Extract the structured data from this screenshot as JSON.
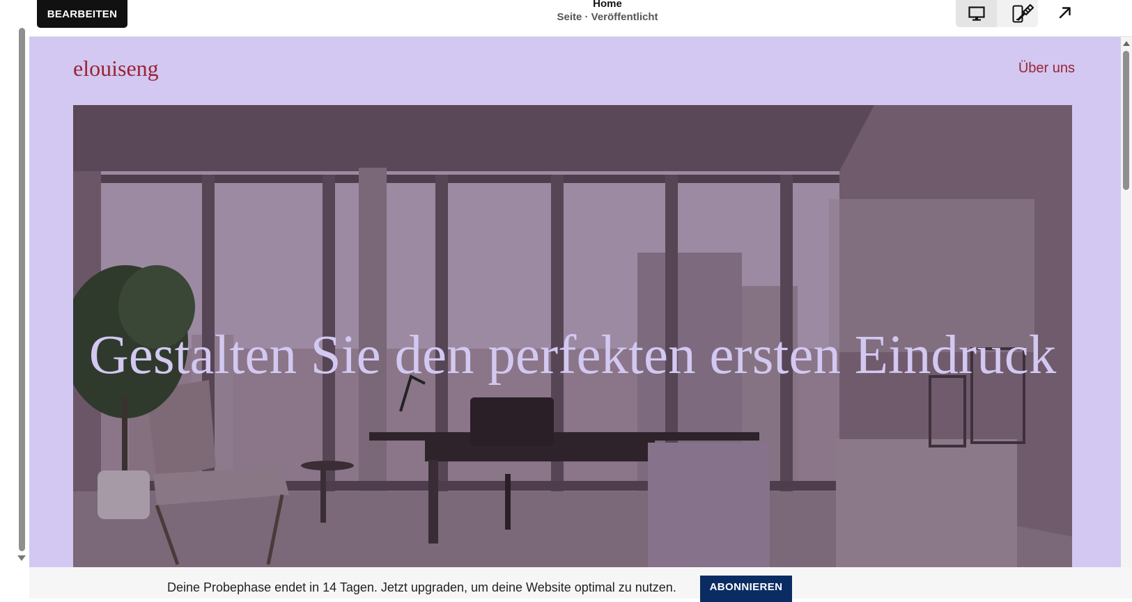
{
  "editor": {
    "edit_label": "BEARBEITEN",
    "page_title": "Home",
    "page_status": "Seite · Veröffentlicht",
    "icons": {
      "desktop": "desktop-icon",
      "mobile": "mobile-icon",
      "style": "paintbrush-icon",
      "open": "arrow-up-right-icon"
    }
  },
  "site": {
    "logo": "elouiseng",
    "nav": [
      "Über uns"
    ],
    "hero_heading": "Gestalten Sie den perfekten ersten Eindruck",
    "colors": {
      "background": "#d2c8f1",
      "accent": "#9a2335",
      "heading": "#d2c8f1"
    }
  },
  "banner": {
    "text": "Deine Probephase endet in 14 Tagen. Jetzt upgraden, um deine Website optimal zu nutzen.",
    "button_label": "ABONNIEREN",
    "button_color": "#0b2c63"
  }
}
